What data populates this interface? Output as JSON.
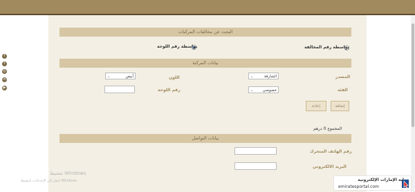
{
  "colors": {
    "gold_bar": "#a08a5e",
    "section_bar": "#d6c6a3",
    "panel": "#f3efe4",
    "accent_blue": "#2a6fd6"
  },
  "social_icons": [
    {
      "name": "facebook-icon",
      "glyph": "f"
    },
    {
      "name": "twitter-icon",
      "glyph": "t"
    },
    {
      "name": "instagram-icon",
      "glyph": "◎"
    },
    {
      "name": "linkedin-icon",
      "glyph": "in"
    },
    {
      "name": "youtube-icon",
      "glyph": "▶"
    }
  ],
  "search_section": {
    "title": "البحث عن مخالفات المركبات",
    "option_fine": "بواسطة رقم المخالفة",
    "option_plate": "بواسطة رقم اللوحة",
    "selected": "plate"
  },
  "vehicle_section": {
    "title": "بيانات المركبة",
    "source_label": "المصدر",
    "source_value": "الشارقة",
    "color_label": "اللون",
    "color_value": "أبيض",
    "category_label": "الفئة",
    "category_value": "خصوصي",
    "plate_label": "رقم اللوحة",
    "plate_value": ""
  },
  "buttons": {
    "add": "إضافة",
    "reset": "إعادة"
  },
  "total_text": "المجموع 0 درهم",
  "contact_section": {
    "title": "بيانات التواصل",
    "mobile_label": "رقم الهاتف المتحرك",
    "email_label": "البريد الالكتروني"
  },
  "watermark": {
    "line1": "تنشيط Windows",
    "line2": "انتقل إلى الإعدادات لتنشيط Windows"
  },
  "portal": {
    "name": "بوابة الإمارات الإلكترونية",
    "url": "emiratesportal.com"
  }
}
